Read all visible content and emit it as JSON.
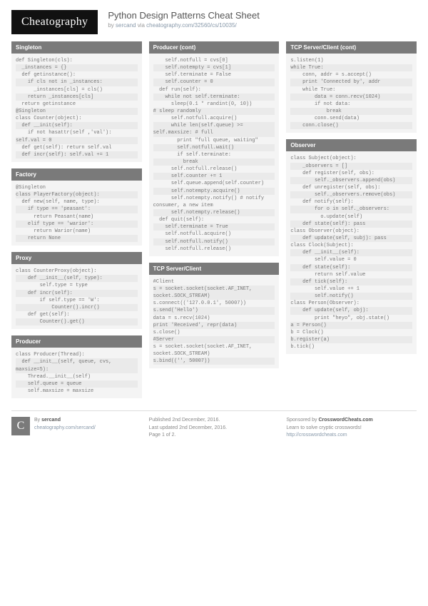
{
  "logo": "Cheatography",
  "title": "Python Design Patterns Cheat Sheet",
  "byline_by": "by ",
  "byline_author": "sercand",
  "byline_via": " via ",
  "byline_url": "cheatography.com/32560/cs/10035/",
  "sections": {
    "singleton": {
      "title": "Singleton",
      "code": "def Singleton(cls):\n  _instances = {}\n  def getinstance():\n    if cls not in _instances:\n      _instances[cls] = cls()\n    return _instances[cls]\n  return getinstance\n@Singleton\nclass Counter(object):\n  def __init(self):\n    if not hasattr(self ,'val'):\nself.val = 0\n  def get(self): return self.val\n  def incr(self): self.val += 1"
    },
    "factory": {
      "title": "Factory",
      "code": "@Singleton\nclass PlayerFactory(object):\n  def new(self, name, type):\n    if type == 'peasant':\n      return Peasant(name)\n    elif type == 'warior':\n      return Warior(name)\n    return None"
    },
    "proxy": {
      "title": "Proxy",
      "code": "class CounterProxy(object):\n    def __init__(self, type):\n        self.type = type\n    def incr(self):\n        if self.type == 'W':\n            Counter().incr()\n    def get(self):\n        Counter().get()"
    },
    "producer": {
      "title": "Producer",
      "code": "class Producer(Thread):\n  def __init__(self, queue, cvs, maxsize=5):\n    Thread.__init__(self)\n    self.queue = queue\n    self.maxsize = maxsize"
    },
    "producer_cont": {
      "title": "Producer (cont)",
      "code": "    self.notfull = cvs[0]\n    self.notempty = cvs[1]\n    self.terminate = False\n    self.counter = 0\n  def run(self):\n    while not self.terminate:\n      sleep(0.1 * randint(0, 10))\n# sleep randomly\n      self.notfull.acquire()\n      while len(self.queue) >= self.maxsize: # full\n        print \"full queue, waiting\"\n        self.notfull.wait()\n        if self.terminate:\n          break\n      self.notfull.release()\n      self.counter += 1\n      self.queue.append(self.counter)\n      self.notempty.acquire()\n      self.notempty.notify() # notify consumer, a new item\n      self.notempty.release()\n  def quit(self):\n    self.terminate = True\n    self.notfull.acquire()\n    self.notfull.notify()\n    self.notfull.release()"
    },
    "tcp": {
      "title": "TCP Server/Client",
      "code": "#Client\ns = socket.socket(socket.AF_INET, socket.SOCK_STREAM)\ns.connect(('127.0.0.1', 50007))\ns.send('Hello')\ndata = s.recv(1024)\nprint 'Received', repr(data)\ns.close()\n#Server\ns = socket.socket(socket.AF_INET, socket.SOCK_STREAM)\ns.bind(('', 50007))"
    },
    "tcp_cont": {
      "title": "TCP Server/Client (cont)",
      "code": "s.listen(1)\nwhile True:\n    conn, addr = s.accept()\n    print 'Connected by', addr\n    while True:\n        data = conn.recv(1024)\n        if not data:\n            break\n        conn.send(data)\n    conn.close()"
    },
    "observer": {
      "title": "Observer",
      "code": "class Subject(object):\n    _observers = []\n    def register(self, obs):\n        self._observers.append(obs)\n    def unregister(self, obs):\n        self._observers.remove(obs)\n    def notify(self):\n        for o in self._observers:\n          o.update(self)\n    def state(self): pass\nclass Observer(object):\n    def update(self, subj): pass\nclass Clock(Subject):\n    def __init__(self):\n        self.value = 0\n    def state(self):\n        return self.value\n    def tick(self):\n        self.value += 1\n        self.notify()\nclass Person(Observer):\n    def update(self, obj):\n        print \"heyo\", obj.state()\na = Person()\nb = Clock()\nb.register(a)\nb.tick()"
    }
  },
  "footer": {
    "col1_by": "By ",
    "col1_author": "sercand",
    "col1_url": "cheatography.com/sercand/",
    "col2_pub": "Published 2nd December, 2016.",
    "col2_upd": "Last updated 2nd December, 2016.",
    "col2_page": "Page 1 of 2.",
    "col3_sponsor": "Sponsored by ",
    "col3_name": "CrosswordCheats.com",
    "col3_tag": "Learn to solve cryptic crosswords!",
    "col3_url": "http://crosswordcheats.com"
  }
}
